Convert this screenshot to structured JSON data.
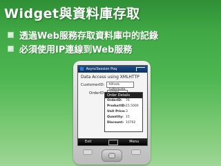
{
  "slide": {
    "title": "Widget與資料庫存取",
    "bullets": [
      "透過Web服務存取資料庫中的記錄",
      "必須使用IP連線到Web服務"
    ]
  },
  "device": {
    "app_title": "AsyncSession Poq",
    "caption": "Data Access using XMLHTTP",
    "customer_label": "CustomerID:",
    "customer_value": "Alfreds Futterkiste",
    "order_label": "OrderID:",
    "order_value": "10702",
    "details_title": "Order Details",
    "details_rows": [
      {
        "key": "OrderID:",
        "value": "76"
      },
      {
        "key": "ProductID:",
        "value": "15.5000"
      },
      {
        "key": "Unit Price:",
        "value": "3"
      },
      {
        "key": "Quantity:",
        "value": "15"
      },
      {
        "key": "Discount:",
        "value": "10702"
      }
    ],
    "softkey_left": "Exit",
    "softkey_right": "Menu"
  }
}
